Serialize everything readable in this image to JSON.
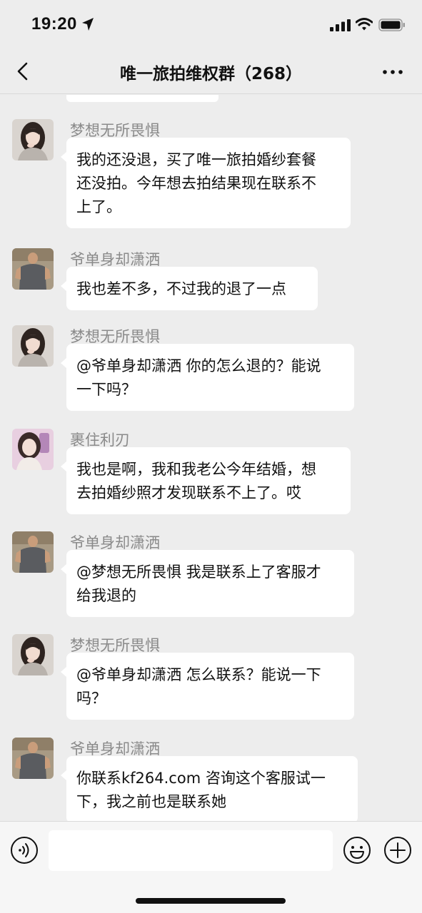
{
  "status": {
    "time": "19:20",
    "icons": [
      "location-arrow-icon",
      "signal-icon",
      "wifi-icon",
      "battery-icon"
    ]
  },
  "nav": {
    "title": "唯一旅拍维权群（268）",
    "back_icon": "chevron-left-icon",
    "more_icon": "more-dots-icon"
  },
  "messages": [
    {
      "sender": "梦想无所畏惧",
      "avatar": "avatar-girl-a",
      "lines": [
        "我的还没退，买了唯一旅拍婚纱套餐",
        "还没拍。今年想去拍结果现在联系不",
        "上了。"
      ]
    },
    {
      "sender": "爷单身却潇洒",
      "avatar": "avatar-man",
      "lines": [
        "我也差不多，不过我的退了一点"
      ]
    },
    {
      "sender": "梦想无所畏惧",
      "avatar": "avatar-girl-a",
      "lines": [
        "@爷单身却潇洒 你的怎么退的？能说",
        "一下吗？"
      ]
    },
    {
      "sender": "裹住利刃",
      "avatar": "avatar-girl-b",
      "lines": [
        "我也是啊，我和我老公今年结婚，想",
        "去拍婚纱照才发现联系不上了。哎"
      ]
    },
    {
      "sender": "爷单身却潇洒",
      "avatar": "avatar-man",
      "lines": [
        "@梦想无所畏惧 我是联系上了客服才",
        "给我退的"
      ]
    },
    {
      "sender": "梦想无所畏惧",
      "avatar": "avatar-girl-a",
      "lines": [
        "@爷单身却潇洒 怎么联系？能说一下",
        "吗？"
      ]
    },
    {
      "sender": "爷单身却潇洒",
      "avatar": "avatar-man",
      "lines": [
        "你联系kf264.com 咨询这个客服试一",
        "下，我之前也是联系她"
      ]
    }
  ],
  "input": {
    "placeholder": "",
    "icons": [
      "voice-icon",
      "emoji-icon",
      "plus-icon"
    ]
  }
}
